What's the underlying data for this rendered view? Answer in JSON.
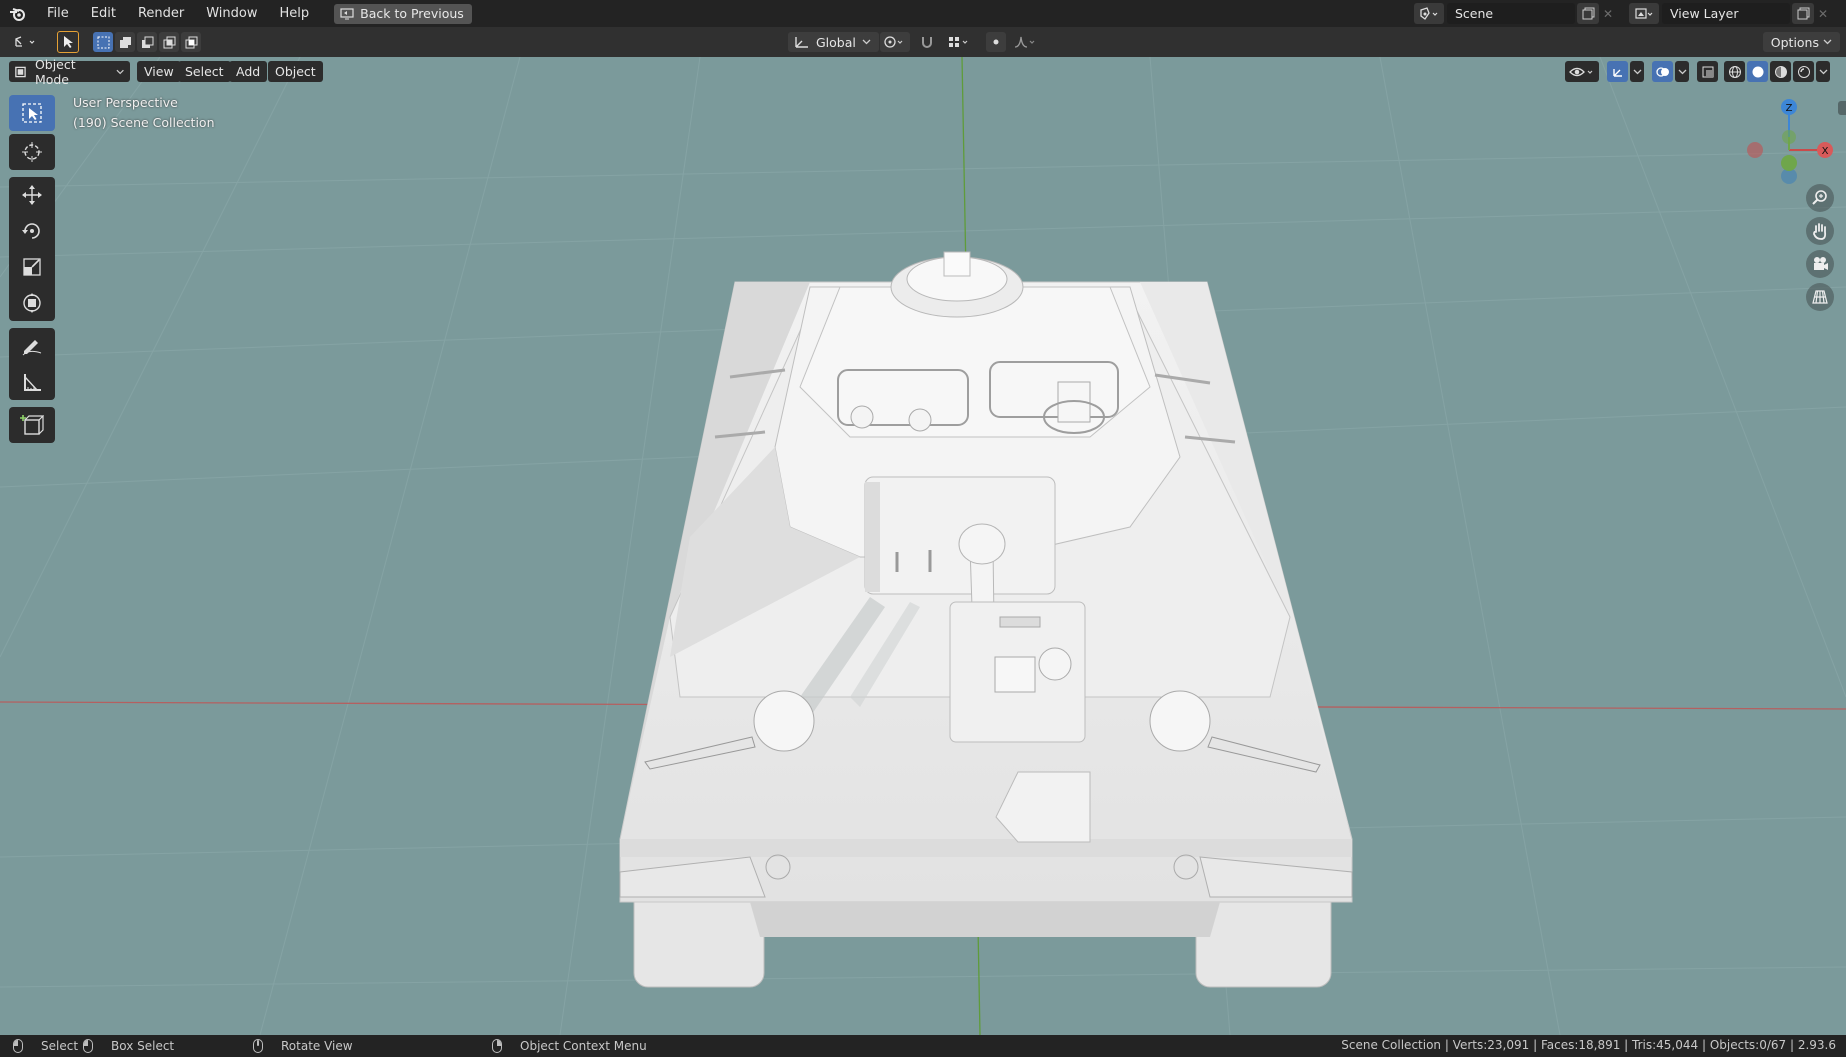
{
  "menubar": {
    "items": [
      "File",
      "Edit",
      "Render",
      "Window",
      "Help"
    ],
    "back_label": "Back to Previous",
    "scene_label": "Scene",
    "view_layer_label": "View Layer"
  },
  "toolheader": {
    "orientation": "Global",
    "options_label": "Options"
  },
  "viewport": {
    "mode": "Object Mode",
    "menus": [
      "View",
      "Select",
      "Add",
      "Object"
    ],
    "perspective": "User Perspective",
    "collection": "(190) Scene Collection",
    "gizmo_axes": [
      "Z",
      "X"
    ],
    "background_color": "#7b9a9b",
    "tools": [
      "select-box-tool",
      "cursor-tool",
      "move-tool",
      "rotate-tool",
      "scale-tool",
      "transform-tool",
      "annotate-tool",
      "measure-tool",
      "add-cube-tool"
    ],
    "active_tool": "select-box-tool"
  },
  "statusbar": {
    "select": "Select",
    "box_select": "Box Select",
    "rotate": "Rotate View",
    "context": "Object Context Menu",
    "stats": "Scene Collection | Verts:23,091 | Faces:18,891 | Tris:45,044 | Objects:0/67 | 2.93.6"
  },
  "colors": {
    "accent": "#4772b3",
    "x_axis": "#c94b4b",
    "y_axis": "#6fa64b",
    "z_axis": "#3d86d6"
  }
}
